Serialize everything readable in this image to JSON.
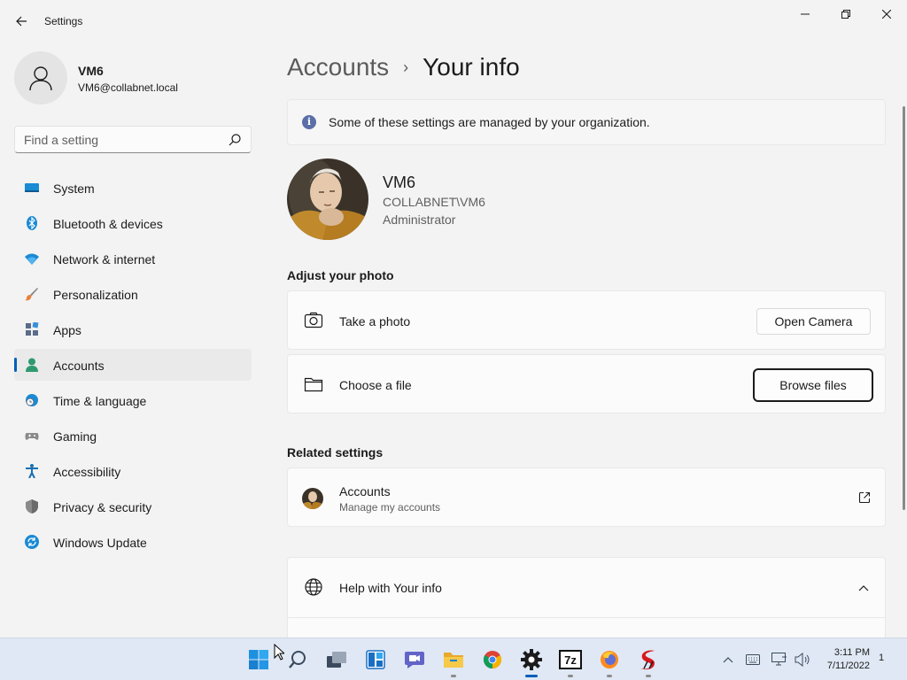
{
  "window": {
    "title": "Settings"
  },
  "user": {
    "name": "VM6",
    "email": "VM6@collabnet.local"
  },
  "search": {
    "placeholder": "Find a setting"
  },
  "sidebar": {
    "items": [
      {
        "label": "System",
        "icon": "system-icon"
      },
      {
        "label": "Bluetooth & devices",
        "icon": "bluetooth-icon"
      },
      {
        "label": "Network & internet",
        "icon": "wifi-icon"
      },
      {
        "label": "Personalization",
        "icon": "brush-icon"
      },
      {
        "label": "Apps",
        "icon": "apps-icon"
      },
      {
        "label": "Accounts",
        "icon": "person-icon",
        "selected": true
      },
      {
        "label": "Time & language",
        "icon": "globe-clock-icon"
      },
      {
        "label": "Gaming",
        "icon": "gamepad-icon"
      },
      {
        "label": "Accessibility",
        "icon": "accessibility-icon"
      },
      {
        "label": "Privacy & security",
        "icon": "shield-icon"
      },
      {
        "label": "Windows Update",
        "icon": "update-icon"
      }
    ]
  },
  "breadcrumb": {
    "parent": "Accounts",
    "separator": "›",
    "current": "Your info"
  },
  "notice": {
    "text": "Some of these settings are managed by your organization."
  },
  "profile": {
    "name": "VM6",
    "domain_user": "COLLABNET\\VM6",
    "role": "Administrator"
  },
  "adjust_photo": {
    "heading": "Adjust your photo",
    "take_photo": {
      "label": "Take a photo",
      "button": "Open Camera"
    },
    "choose_file": {
      "label": "Choose a file",
      "button": "Browse files"
    }
  },
  "related": {
    "heading": "Related settings",
    "accounts": {
      "title": "Accounts",
      "subtitle": "Manage my accounts"
    }
  },
  "help": {
    "title": "Help with Your info"
  },
  "taskbar": {
    "apps": [
      "start",
      "search",
      "task-view",
      "widgets",
      "teams-chat",
      "file-explorer",
      "chrome",
      "settings",
      "7zip",
      "firefox",
      "rdp"
    ],
    "time": "3:11 PM",
    "date": "7/11/2022",
    "notification_count": "1"
  },
  "colors": {
    "accent": "#005fb8",
    "background": "#f3f3f3",
    "card": "#fbfbfb",
    "taskbar": "#dfe8f4"
  }
}
